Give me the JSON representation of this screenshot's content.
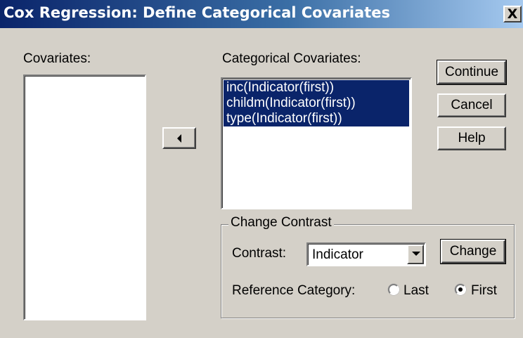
{
  "window": {
    "title": "Cox Regression: Define Categorical Covariates",
    "close_label": "X"
  },
  "covariates": {
    "label": "Covariates:",
    "items": []
  },
  "categorical": {
    "label": "Categorical Covariates:",
    "items": [
      "inc(Indicator(first))",
      "childm(Indicator(first))",
      "type(Indicator(first))"
    ]
  },
  "buttons": {
    "continue": "Continue",
    "cancel": "Cancel",
    "help": "Help",
    "change": "Change"
  },
  "change_contrast": {
    "group_label": "Change Contrast",
    "contrast_label": "Contrast:",
    "contrast_value": "Indicator",
    "reference_label": "Reference Category:",
    "options": [
      {
        "label": "Last",
        "selected": false
      },
      {
        "label": "First",
        "selected": true
      }
    ]
  },
  "colors": {
    "dialog_bg": "#d4d0c8",
    "title_bar": "#0a246a",
    "selection": "#0a246a"
  },
  "icons": {
    "move_left": "arrow-left-icon",
    "combo": "chevron-down-icon"
  }
}
